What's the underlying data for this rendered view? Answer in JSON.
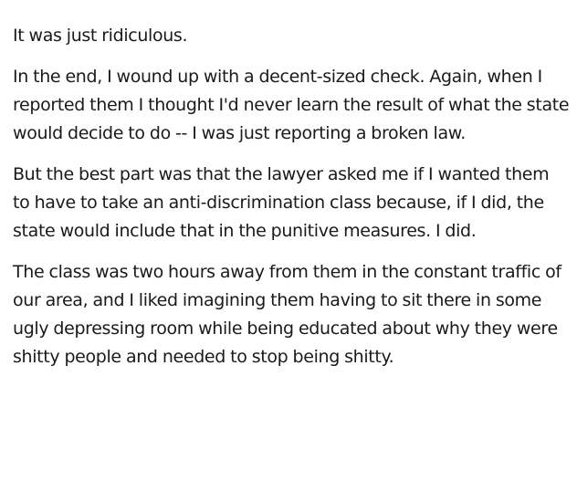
{
  "post": {
    "paragraphs": [
      "It was just ridiculous.",
      "In the end, I wound up with a decent-sized check. Again, when I reported them I thought I'd never learn the result of what the state would decide to do -- I was just reporting a broken law.",
      "But the best part was that the lawyer asked me if I wanted them to have to take an anti-discrimination class because, if I did, the state would include that in the punitive measures. I did.",
      "The class was two hours away from them in the constant traffic of our area, and I liked imagining them having to sit there in some ugly depressing room while being educated about why they were shitty people and needed to stop being shitty."
    ]
  },
  "colors": {
    "text": "#1a1a1b",
    "background": "#ffffff"
  }
}
